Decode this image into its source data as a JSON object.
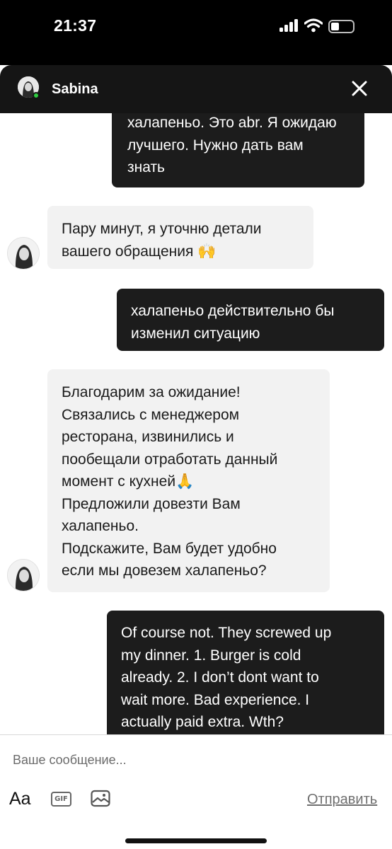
{
  "status_bar": {
    "time": "21:37"
  },
  "header": {
    "contact_name": "Sabina",
    "online": true
  },
  "messages": [
    {
      "direction": "outgoing",
      "text": "халапеньо. Это abr. Я ожидаю\nлучшего. Нужно дать вам\nзнать"
    },
    {
      "direction": "incoming",
      "text": "Пару минут, я уточню детали\nвашего обращения 🙌"
    },
    {
      "direction": "outgoing",
      "text": "халапеньо действительно бы\nизменил ситуацию"
    },
    {
      "direction": "incoming",
      "text": "Благодарим за ожидание!\nСвязались с менеджером\nресторана, извинились и\nпообещали отработать данный\nмомент с кухней🙏\nПредложили довезти Вам\nхалапеньо.\nПодскажите, Вам будет удобно\nесли мы довезем халапеньо?"
    },
    {
      "direction": "outgoing",
      "text": "Of course not. They screwed up\nmy dinner. 1. Burger is cold\nalready. 2. I don’t dont want to\nwait more. Bad experience. I\nactually paid extra. Wth?"
    }
  ],
  "composer": {
    "placeholder": "Ваше сообщение...",
    "value": "",
    "format_label": "Aa",
    "gif_label": "GIF",
    "send_label": "Отправить"
  },
  "icons": {
    "close": "close-icon",
    "image": "image-icon",
    "signal": "cellular-signal-icon",
    "wifi": "wifi-icon",
    "battery": "battery-icon"
  },
  "colors": {
    "outgoing_bubble": "#1c1c1c",
    "incoming_bubble": "#f2f2f2",
    "header_bg": "#151515",
    "online_dot": "#2ecc40"
  }
}
